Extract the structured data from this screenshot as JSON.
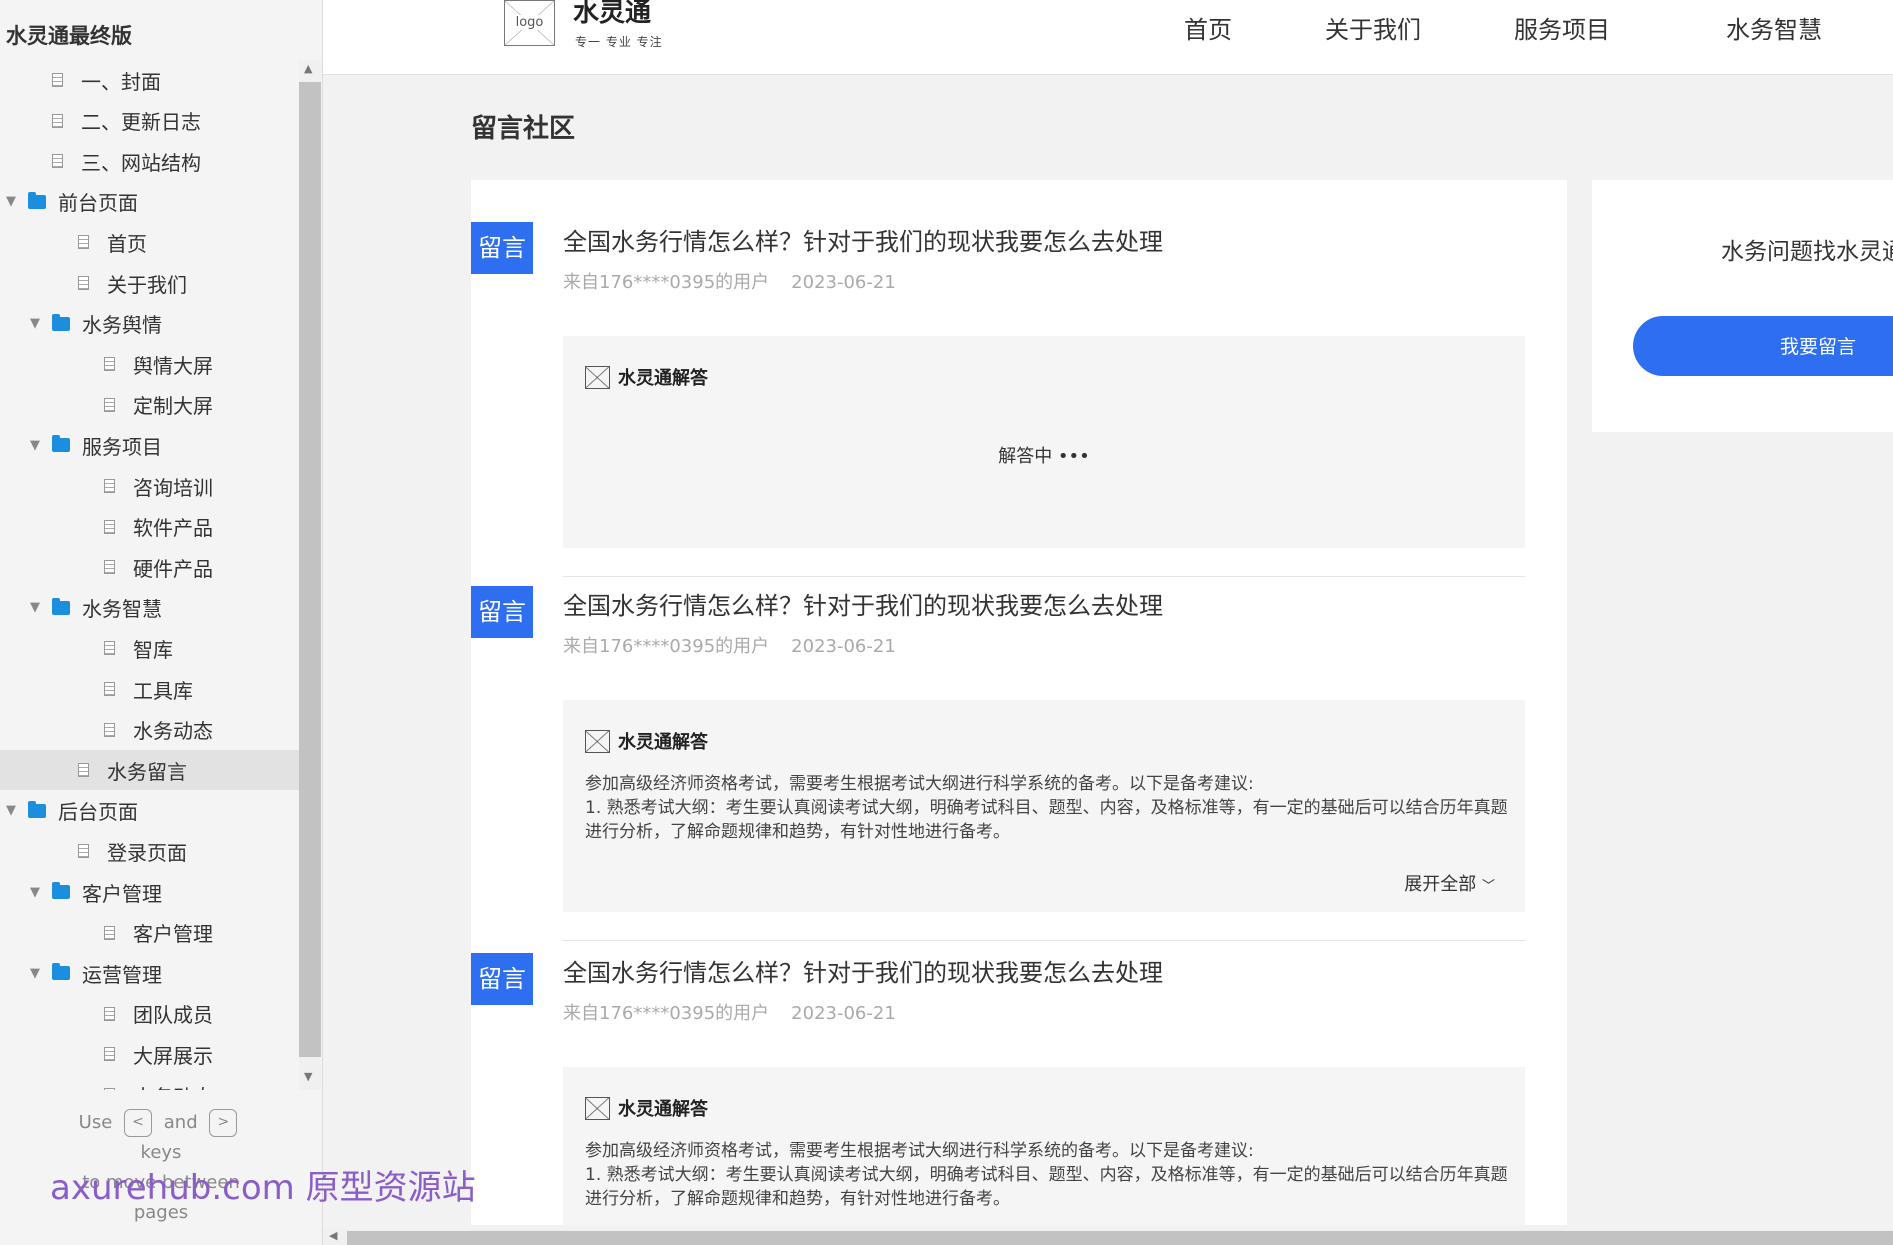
{
  "sidebar": {
    "title": "水灵通最终版",
    "items": [
      {
        "label": "一、封面",
        "type": "page",
        "level": 1
      },
      {
        "label": "二、更新日志",
        "type": "page",
        "level": 1
      },
      {
        "label": "三、网站结构",
        "type": "page",
        "level": 1
      },
      {
        "label": "前台页面",
        "type": "folder",
        "level": 0
      },
      {
        "label": "首页",
        "type": "page",
        "level": 2
      },
      {
        "label": "关于我们",
        "type": "page",
        "level": 2
      },
      {
        "label": "水务舆情",
        "type": "folder",
        "level": 1
      },
      {
        "label": "舆情大屏",
        "type": "page",
        "level": 3
      },
      {
        "label": "定制大屏",
        "type": "page",
        "level": 3
      },
      {
        "label": "服务项目",
        "type": "folder",
        "level": 1
      },
      {
        "label": "咨询培训",
        "type": "page",
        "level": 3
      },
      {
        "label": "软件产品",
        "type": "page",
        "level": 3
      },
      {
        "label": "硬件产品",
        "type": "page",
        "level": 3
      },
      {
        "label": "水务智慧",
        "type": "folder",
        "level": 1
      },
      {
        "label": "智库",
        "type": "page",
        "level": 3
      },
      {
        "label": "工具库",
        "type": "page",
        "level": 3
      },
      {
        "label": "水务动态",
        "type": "page",
        "level": 3
      },
      {
        "label": "水务留言",
        "type": "page",
        "level": 2,
        "selected": true
      },
      {
        "label": "后台页面",
        "type": "folder",
        "level": 0
      },
      {
        "label": "登录页面",
        "type": "page",
        "level": 2
      },
      {
        "label": "客户管理",
        "type": "folder",
        "level": 1
      },
      {
        "label": "客户管理",
        "type": "page",
        "level": 3
      },
      {
        "label": "运营管理",
        "type": "folder",
        "level": 1
      },
      {
        "label": "团队成员",
        "type": "page",
        "level": 3
      },
      {
        "label": "大屏展示",
        "type": "page",
        "level": 3
      },
      {
        "label": "水务动态",
        "type": "page",
        "level": 3
      }
    ],
    "hint": {
      "use": "Use",
      "and": "and",
      "key_prev": "<",
      "key_next": ">",
      "line2": "keys",
      "line3": "to move between",
      "line4": "pages"
    }
  },
  "watermark": "axurehub.com 原型资源站",
  "header": {
    "logo_text": "logo",
    "brand": "水灵通",
    "slogan": "专一 专业 专注",
    "nav": [
      "首页",
      "关于我们",
      "服务项目",
      "水务智慧"
    ]
  },
  "main": {
    "title": "留言社区",
    "posts": [
      {
        "badge": "留言",
        "title": "全国水务行情怎么样？针对于我们的现状我要怎么去处理",
        "user": "来自176****0395的用户",
        "date": "2023-06-21",
        "answer_label": "水灵通解答",
        "pending": "解答中 •••"
      },
      {
        "badge": "留言",
        "title": "全国水务行情怎么样？针对于我们的现状我要怎么去处理",
        "user": "来自176****0395的用户",
        "date": "2023-06-21",
        "answer_label": "水灵通解答",
        "answer_line1": "参加高级经济师资格考试，需要考生根据考试大纲进行科学系统的备考。以下是备考建议:",
        "answer_line2": "1. 熟悉考试大纲：考生要认真阅读考试大纲，明确考试科目、题型、内容，及格标准等，有一定的基础后可以结合历年真题进行分析，了解命题规律和趋势，有针对性地进行备考。",
        "expand": "展开全部"
      },
      {
        "badge": "留言",
        "title": "全国水务行情怎么样？针对于我们的现状我要怎么去处理",
        "user": "来自176****0395的用户",
        "date": "2023-06-21",
        "answer_label": "水灵通解答",
        "answer_line1": "参加高级经济师资格考试，需要考生根据考试大纲进行科学系统的备考。以下是备考建议:",
        "answer_line2": "1. 熟悉考试大纲：考生要认真阅读考试大纲，明确考试科目、题型、内容，及格标准等，有一定的基础后可以结合历年真题进行分析，了解命题规律和趋势，有针对性地进行备考。"
      }
    ]
  },
  "side_card": {
    "text": "水务问题找水灵通",
    "button": "我要留言"
  },
  "colors": {
    "accent": "#2d6ff0",
    "folder": "#1b8fde"
  }
}
